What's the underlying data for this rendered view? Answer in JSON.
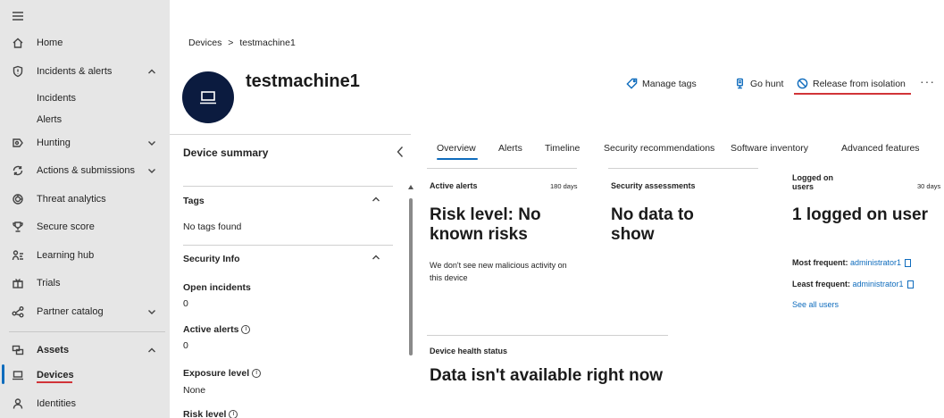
{
  "nav": {
    "home": "Home",
    "incidents_alerts": "Incidents & alerts",
    "incidents": "Incidents",
    "alerts": "Alerts",
    "hunting": "Hunting",
    "actions_submissions": "Actions & submissions",
    "threat_analytics": "Threat analytics",
    "secure_score": "Secure score",
    "learning_hub": "Learning hub",
    "trials": "Trials",
    "partner_catalog": "Partner catalog",
    "assets": "Assets",
    "devices": "Devices",
    "identities": "Identities"
  },
  "breadcrumb": {
    "root": "Devices",
    "sep": ">",
    "current": "testmachine1"
  },
  "device": {
    "name": "testmachine1"
  },
  "actions": {
    "manage_tags": "Manage tags",
    "go_hunt": "Go hunt",
    "release": "Release from isolation",
    "more": "···"
  },
  "summary": {
    "title": "Device summary",
    "tags_title": "Tags",
    "tags_value": "No tags found",
    "security_info_title": "Security Info",
    "open_incidents_label": "Open incidents",
    "open_incidents_value": "0",
    "active_alerts_label": "Active alerts",
    "active_alerts_value": "0",
    "exposure_label": "Exposure level",
    "exposure_value": "None",
    "risk_label": "Risk level"
  },
  "tabs": [
    "Overview",
    "Alerts",
    "Timeline",
    "Security recommendations",
    "Software inventory",
    "Advanced features"
  ],
  "cards": {
    "active_alerts": {
      "label": "Active alerts",
      "days": "180 days",
      "headline": "Risk level: No known risks",
      "note": "We don't see new malicious activity on this device"
    },
    "security_assessments": {
      "label": "Security assessments",
      "headline": "No data to show"
    },
    "logged_on": {
      "label": "Logged on users",
      "days": "30 days",
      "headline": "1 logged on user",
      "most_label": "Most frequent:",
      "most_value": "administrator1",
      "least_label": "Least frequent:",
      "least_value": "administrator1",
      "see_all": "See all users"
    },
    "health": {
      "label": "Device health status",
      "headline": "Data isn't available right now"
    }
  },
  "colors": {
    "accent": "#0f6cbd",
    "avatar_bg": "#0b1b3f",
    "annotation_red": "#d13438",
    "nav_bg": "#e6e6e6"
  }
}
